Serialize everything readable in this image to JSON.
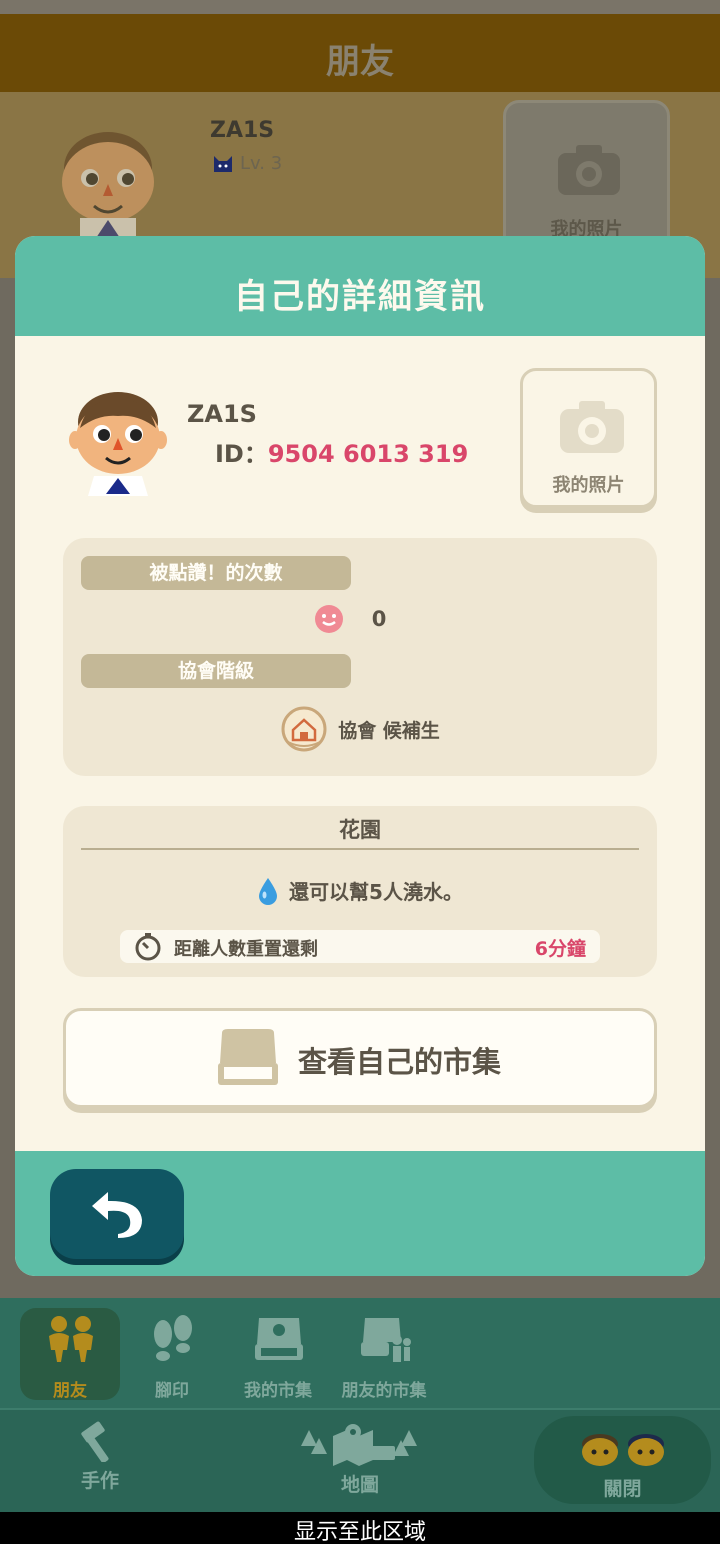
{
  "background": {
    "header_title": "朋友",
    "friend_name": "ZA1S",
    "friend_level": "Lv. 3",
    "photo_label": "我的照片"
  },
  "dialog": {
    "title": "自己的詳細資訊",
    "name": "ZA1S",
    "id_label": "ID：",
    "id_value": "9504 6013 319",
    "photo_label": "我的照片",
    "likes": {
      "label": "被點讚！的次數",
      "count": "0"
    },
    "rank": {
      "label": "協會階級",
      "value": "協會 候補生"
    },
    "garden": {
      "title": "花園",
      "water_text": "還可以幫5人澆水。",
      "reset_label": "距離人數重置還剩",
      "reset_value": "6分鐘"
    },
    "market_button": "查看自己的市集"
  },
  "nav": {
    "tabs": [
      {
        "label": "朋友",
        "icon": "friends-icon",
        "active": true
      },
      {
        "label": "腳印",
        "icon": "footprints-icon",
        "active": false
      },
      {
        "label": "我的市集",
        "icon": "my-market-icon",
        "active": false
      },
      {
        "label": "朋友的市集",
        "icon": "friends-market-icon",
        "active": false
      }
    ],
    "craft": "手作",
    "map": "地圖",
    "close": "關閉"
  },
  "system": {
    "overlay_text": "显示至此区域"
  },
  "colors": {
    "teal": "#5dbda6",
    "cream": "#faf5e6",
    "accent_pink": "#d9466a",
    "back_button": "#105663"
  }
}
